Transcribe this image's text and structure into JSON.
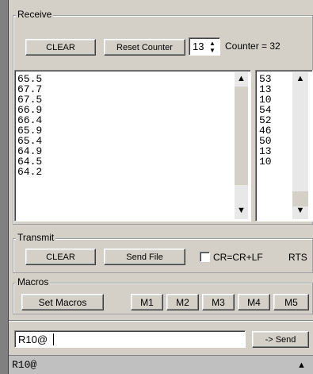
{
  "receive": {
    "legend": "Receive",
    "clear_label": "CLEAR",
    "reset_counter_label": "Reset Counter",
    "counter_value": "13",
    "counter_label": "Counter = 32",
    "main_lines": [
      "65.5",
      "67.7",
      "67.5",
      "66.9",
      "66.4",
      "65.9",
      "65.4",
      "64.9",
      "64.5",
      "64.2"
    ],
    "count_lines": [
      "53",
      "13",
      "10",
      "54",
      "52",
      "46",
      "50",
      "13",
      "10"
    ],
    "scroll_up_icon": "▲",
    "scroll_down_icon": "▼"
  },
  "transmit": {
    "legend": "Transmit",
    "clear_label": "CLEAR",
    "send_file_label": "Send File",
    "cr_label": "CR=CR+LF",
    "rts_label": "RTS"
  },
  "macros": {
    "legend": "Macros",
    "set_label": "Set Macros",
    "items": [
      "M1",
      "M2",
      "M3",
      "M4",
      "M5"
    ]
  },
  "send": {
    "input_value": "R10@",
    "button_label": "-> Send"
  },
  "output": {
    "text": "R10@",
    "scroll_up_icon": "▲"
  },
  "colors": {
    "face": "#d4d0c8",
    "left_bar": "#808080",
    "output_bg": "#c0c0c0"
  }
}
